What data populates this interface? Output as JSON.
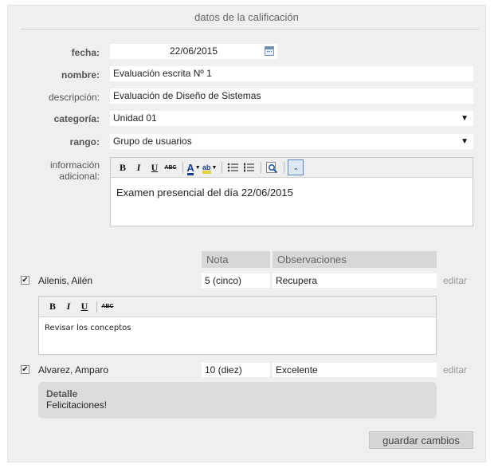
{
  "panel": {
    "title": "datos de la calificación"
  },
  "form": {
    "fecha": {
      "label": "fecha:",
      "value": "22/06/2015"
    },
    "nombre": {
      "label": "nombre:",
      "value": "Evaluación escrita Nº 1"
    },
    "descripcion": {
      "label": "descripción:",
      "value": "Evaluación de Diseño de Sistemas"
    },
    "categoria": {
      "label": "categoría:",
      "value": "Unidad 01"
    },
    "rango": {
      "label": "rango:",
      "value": "Grupo de usuarios"
    },
    "info": {
      "label_line1": "información",
      "label_line2": "adicional:",
      "content": "Examen presencial del día 22/06/2015"
    }
  },
  "toolbar": {
    "bold": "B",
    "italic": "I",
    "underline": "U",
    "strike": "ABC",
    "font_color": "A",
    "highlight": "ab"
  },
  "grades": {
    "headers": {
      "nota": "Nota",
      "observaciones": "Observaciones"
    },
    "edit_label": "editar",
    "rows": [
      {
        "name": "Ailenis, Ailén",
        "nota": "5 (cinco)",
        "obs": "Recupera",
        "checked": true,
        "editor_content": "Revisar los conceptos"
      },
      {
        "name": "Alvarez, Amparo",
        "nota": "10 (diez)",
        "obs": "Excelente",
        "checked": true,
        "detail_title": "Detalle",
        "detail_text": "Felicitaciones!"
      }
    ]
  },
  "save_label": "guardar cambios",
  "colors": {
    "panel_bg": "#efefef",
    "header_bg": "#d7d7d7",
    "detail_bg": "#dcdcdc",
    "active_tool": "#dce7f7"
  }
}
